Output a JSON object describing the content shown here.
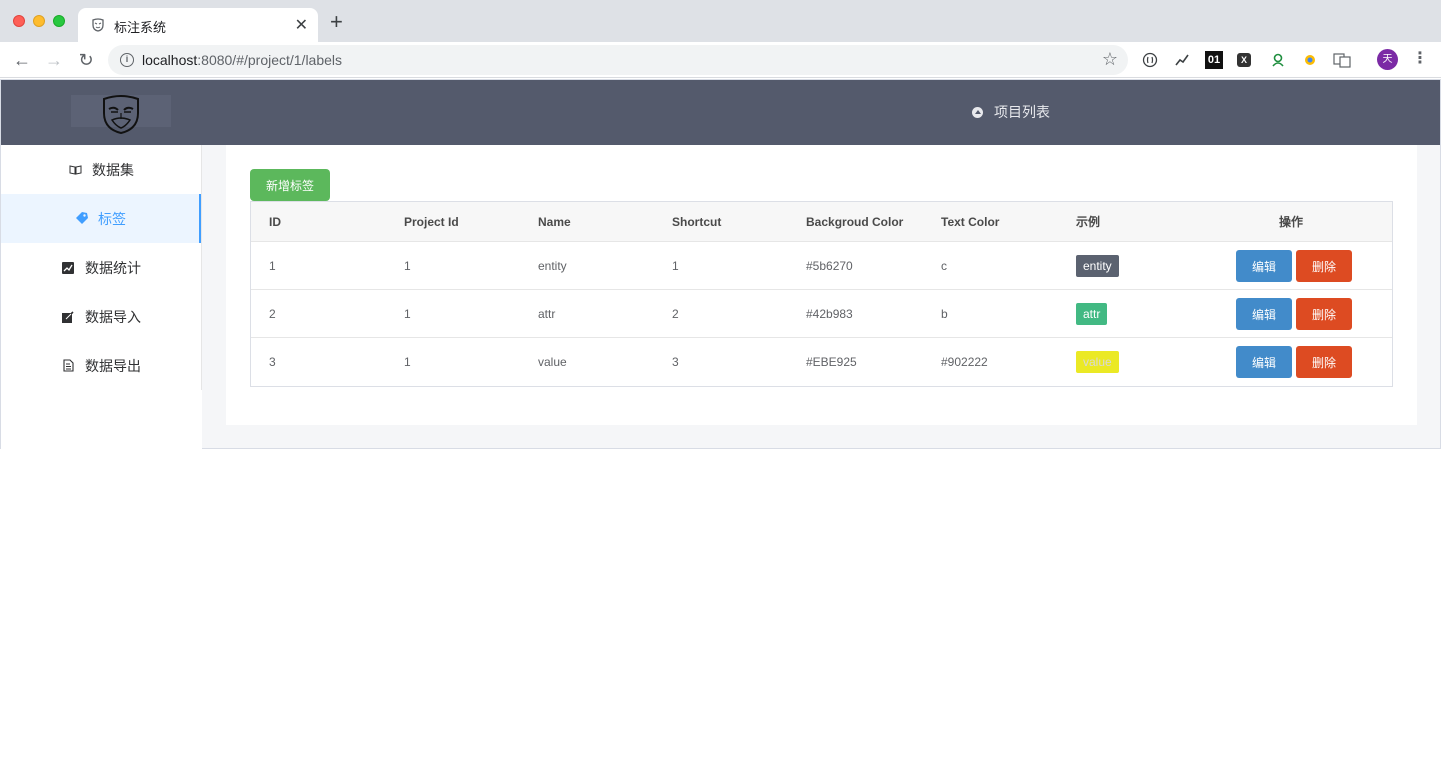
{
  "browser": {
    "tab_title": "标注系统",
    "url_host": "localhost",
    "url_rest": ":8080/#/project/1/labels",
    "avatar_letter": "天",
    "extensions": [
      "ext-icon-1",
      "ext-icon-2",
      "01",
      "X",
      "ext-icon-5",
      "ext-icon-6",
      "translate-icon"
    ]
  },
  "header": {
    "logo_alt": "mask-logo",
    "nav_link": "项目列表"
  },
  "sidebar": {
    "items": [
      {
        "label": "数据集",
        "icon": "book-icon"
      },
      {
        "label": "标签",
        "icon": "tag-icon"
      },
      {
        "label": "数据统计",
        "icon": "chart-icon"
      },
      {
        "label": "数据导入",
        "icon": "edit-icon"
      },
      {
        "label": "数据导出",
        "icon": "file-icon"
      }
    ],
    "active_index": 1
  },
  "main": {
    "add_button": "新增标签",
    "table": {
      "headers": [
        "ID",
        "Project Id",
        "Name",
        "Shortcut",
        "Backgroud Color",
        "Text Color",
        "示例",
        "操作"
      ],
      "rows": [
        {
          "id": "1",
          "project_id": "1",
          "name": "entity",
          "shortcut": "1",
          "bg": "#5b6270",
          "text_color": "c",
          "sample": "entity",
          "sample_bg": "#5b6270",
          "sample_fg": "#ffffff"
        },
        {
          "id": "2",
          "project_id": "1",
          "name": "attr",
          "shortcut": "2",
          "bg": "#42b983",
          "text_color": "b",
          "sample": "attr",
          "sample_bg": "#42b983",
          "sample_fg": "#ffffff"
        },
        {
          "id": "3",
          "project_id": "1",
          "name": "value",
          "shortcut": "3",
          "bg": "#EBE925",
          "text_color": "#902222",
          "sample": "value",
          "sample_bg": "#EBE925",
          "sample_fg": "#d8d8d8"
        }
      ],
      "edit_label": "编辑",
      "delete_label": "删除"
    }
  },
  "colors": {
    "header_bg": "#545a6c",
    "accent": "#409eff",
    "add_btn": "#5cb85c",
    "edit_btn": "#428bca",
    "delete_btn": "#dd4b22"
  }
}
